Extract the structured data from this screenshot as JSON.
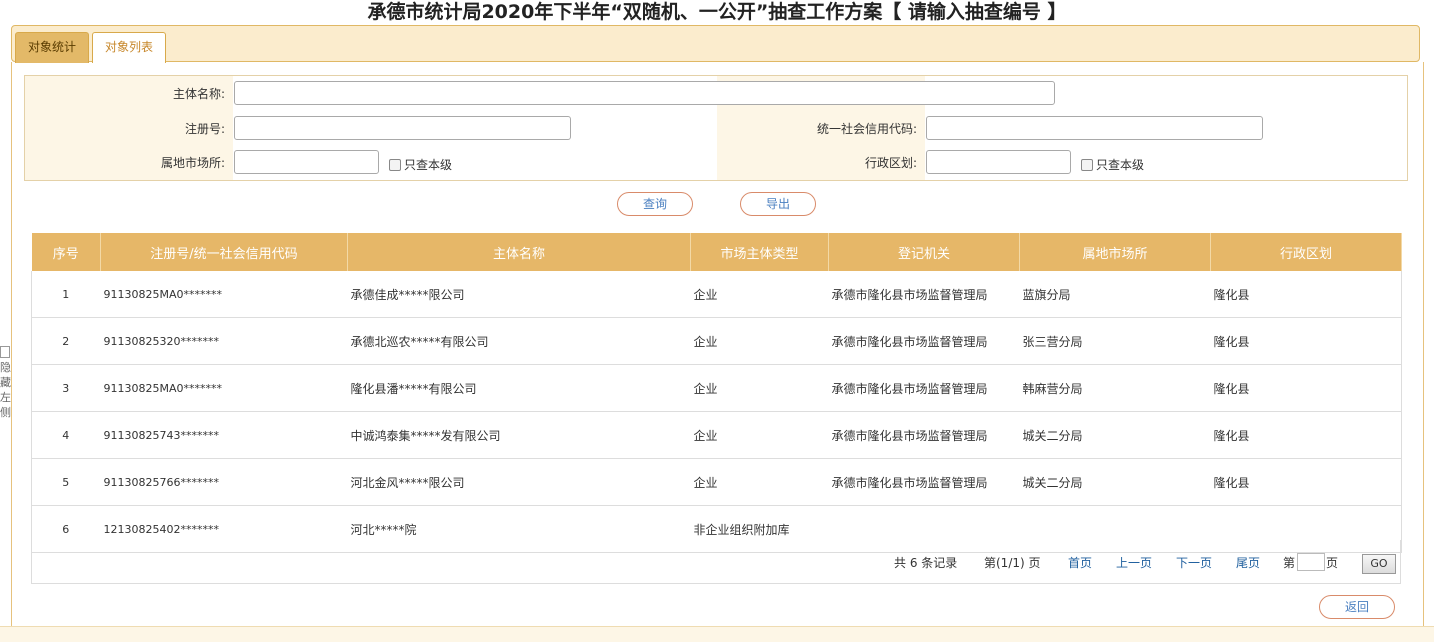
{
  "page": {
    "title": "承德市统计局2020年下半年“双随机、一公开”抽查工作方案【 请输入抽查编号 】",
    "side_text": [
      "隐",
      "藏",
      "左",
      "侧"
    ]
  },
  "tabs": [
    {
      "label": "对象统计"
    },
    {
      "label": "对象列表"
    }
  ],
  "form": {
    "subject_name": {
      "label": "主体名称:",
      "value": ""
    },
    "reg_no": {
      "label": "注册号:",
      "value": ""
    },
    "credit_code": {
      "label": "统一社会信用代码:",
      "value": ""
    },
    "market_office": {
      "label": "属地市场所:",
      "value": "",
      "check_label": "只查本级"
    },
    "admin_region": {
      "label": "行政区划:",
      "value": "",
      "check_label": "只查本级"
    }
  },
  "buttons": {
    "query": "查询",
    "export": "导出",
    "back": "返回"
  },
  "table": {
    "columns": [
      "序号",
      "注册号/统一社会信用代码",
      "主体名称",
      "市场主体类型",
      "登记机关",
      "属地市场所",
      "行政区划"
    ],
    "rows": [
      [
        "1",
        "91130825MA0*******",
        "承德佳成*****限公司",
        "企业",
        "承德市隆化县市场监督管理局",
        "蓝旗分局",
        "隆化县"
      ],
      [
        "2",
        "91130825320*******",
        "承德北巡农*****有限公司",
        "企业",
        "承德市隆化县市场监督管理局",
        "张三营分局",
        "隆化县"
      ],
      [
        "3",
        "91130825MA0*******",
        "隆化县潘*****有限公司",
        "企业",
        "承德市隆化县市场监督管理局",
        "韩麻营分局",
        "隆化县"
      ],
      [
        "4",
        "91130825743*******",
        "中诚鸿泰集*****发有限公司",
        "企业",
        "承德市隆化县市场监督管理局",
        "城关二分局",
        "隆化县"
      ],
      [
        "5",
        "91130825766*******",
        "河北金风*****限公司",
        "企业",
        "承德市隆化县市场监督管理局",
        "城关二分局",
        "隆化县"
      ],
      [
        "6",
        "12130825402*******",
        "河北*****院",
        "非企业组织附加库",
        "",
        "",
        ""
      ]
    ]
  },
  "pager": {
    "total": "共 6 条记录",
    "page": "第(1/1) 页",
    "first": "首页",
    "prev": "上一页",
    "next": "下一页",
    "last": "尾页",
    "goto_prefix": "第",
    "goto_suffix": "页",
    "goto_value": "",
    "go": "GO"
  }
}
